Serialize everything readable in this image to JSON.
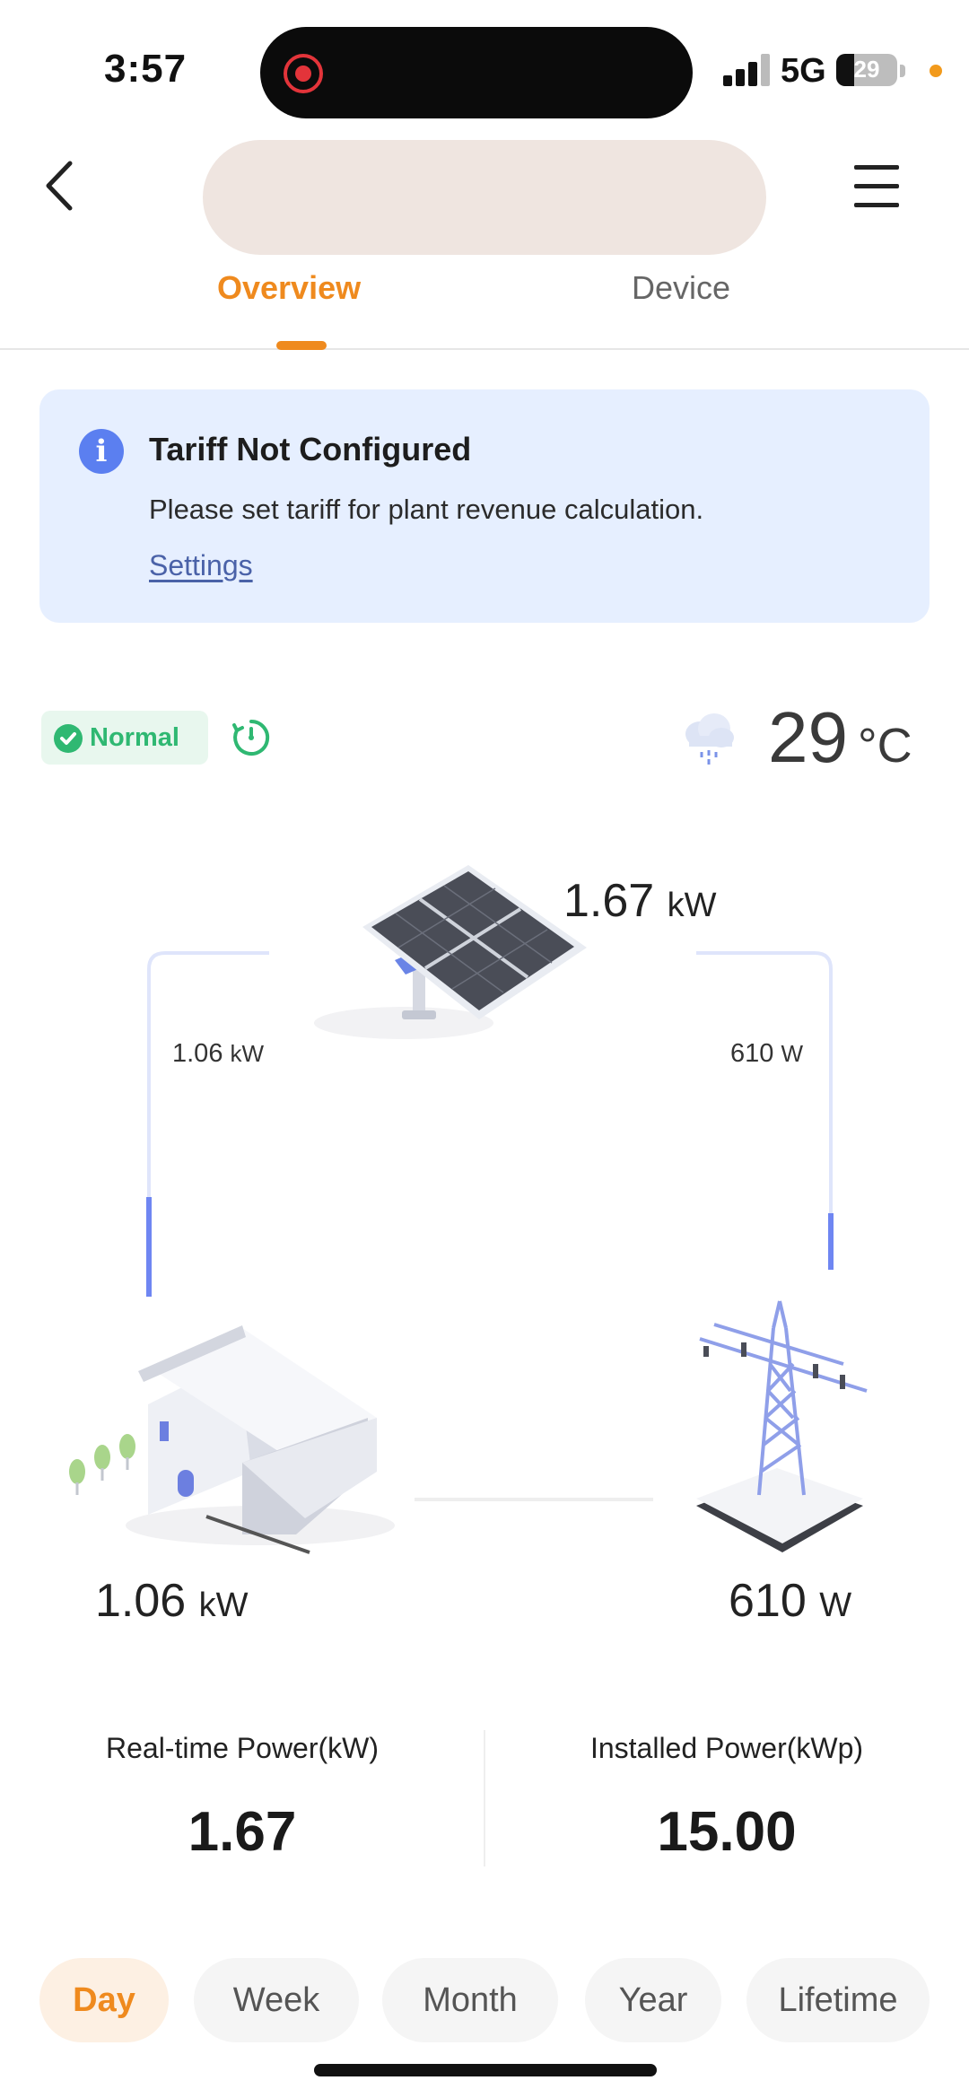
{
  "status_bar": {
    "time": "3:57",
    "network": "5G",
    "battery_level": "29"
  },
  "header": {
    "tabs": [
      {
        "label": "Overview",
        "active": true
      },
      {
        "label": "Device",
        "active": false
      }
    ]
  },
  "notice": {
    "title": "Tariff Not Configured",
    "body": "Please set tariff for plant revenue calculation.",
    "link": "Settings",
    "icon": "info-icon"
  },
  "plant_status": {
    "label": "Normal",
    "weather_icon": "rain-cloud-icon",
    "temperature": "29",
    "temperature_unit": "°C"
  },
  "energy_flow": {
    "pv": {
      "value": "1.67",
      "unit": "kW"
    },
    "pv_to_home": {
      "value": "1.06",
      "unit": "kW"
    },
    "pv_to_grid": {
      "value": "610",
      "unit": "W"
    },
    "home": {
      "value": "1.06",
      "unit": "kW"
    },
    "grid": {
      "value": "610",
      "unit": "W"
    }
  },
  "metrics": {
    "realtime_label": "Real-time Power(kW)",
    "realtime_value": "1.67",
    "installed_label": "Installed Power(kWp)",
    "installed_value": "15.00"
  },
  "periods": [
    "Day",
    "Week",
    "Month",
    "Year",
    "Lifetime"
  ],
  "colors": {
    "accent": "#ef8a1e",
    "normal": "#2fb872",
    "notice_bg": "#e6efff",
    "flow_line": "#6f86f2"
  }
}
